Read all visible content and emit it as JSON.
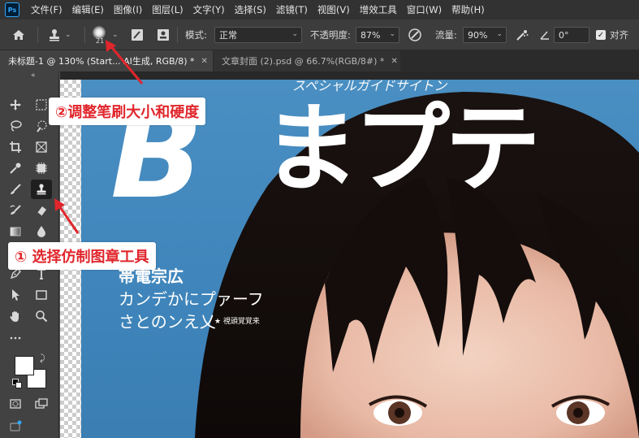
{
  "menubar": {
    "logo": "Ps",
    "items": [
      "文件(F)",
      "编辑(E)",
      "图像(I)",
      "图层(L)",
      "文字(Y)",
      "选择(S)",
      "滤镜(T)",
      "视图(V)",
      "增效工具",
      "窗口(W)",
      "帮助(H)"
    ]
  },
  "options": {
    "brush_size": "21",
    "mode_label": "模式:",
    "mode_value": "正常",
    "opacity_label": "不透明度:",
    "opacity_value": "87%",
    "flow_label": "流量:",
    "flow_value": "90%",
    "angle_value": "0°",
    "align_label": "对齐",
    "align_checked": true
  },
  "tabs": [
    {
      "label": "未标题-1 @ 130% (Start... AI生成, RGB/8) *",
      "active": true
    },
    {
      "label": "文章封面 (2).psd @ 66.7%(RGB/8#) *",
      "active": false
    }
  ],
  "canvas": {
    "top_text": "スペシャルガイドサイトン",
    "big_title_latin": "B",
    "big_title_kana": "まプテ",
    "line1": "帯電宗広",
    "line2": "カンデかにプァーフ",
    "line3": "さとのンえ乂",
    "small_note": "★ 視頭覚覚来"
  },
  "annotations": {
    "step1": "① 选择仿制图章工具",
    "step2": "②调整笔刷大小和硬度"
  },
  "colors": {
    "accent_red": "#e0262c",
    "photoshop_blue": "#31a8ff",
    "cover_blue": "#4a8fc2"
  }
}
